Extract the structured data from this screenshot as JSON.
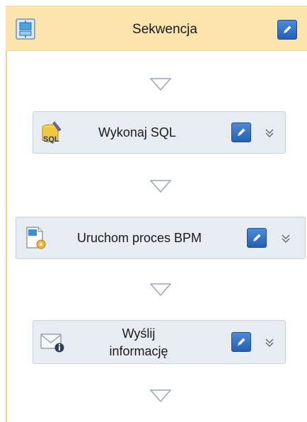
{
  "sequence": {
    "title": "Sekwencja",
    "icon": "sequence-icon",
    "edit_icon": "pencil-icon"
  },
  "activities": [
    {
      "label": "Wykonaj SQL",
      "icon": "sql-icon",
      "edit_icon": "pencil-icon",
      "expand_icon": "double-chevron-down-icon"
    },
    {
      "label": "Uruchom proces BPM",
      "icon": "bpm-process-icon",
      "edit_icon": "pencil-icon",
      "expand_icon": "double-chevron-down-icon"
    },
    {
      "label_line1": "Wyślij",
      "label_line2": "informację",
      "icon": "mail-info-icon",
      "edit_icon": "pencil-icon",
      "expand_icon": "double-chevron-down-icon"
    }
  ],
  "connector_icon": "arrow-down-triangle-icon",
  "colors": {
    "header_bg": "#fbe4ad",
    "card_bg": "#e7ebf2",
    "edit_button": "#2f6cc1",
    "connector": "#9aa6b8"
  }
}
